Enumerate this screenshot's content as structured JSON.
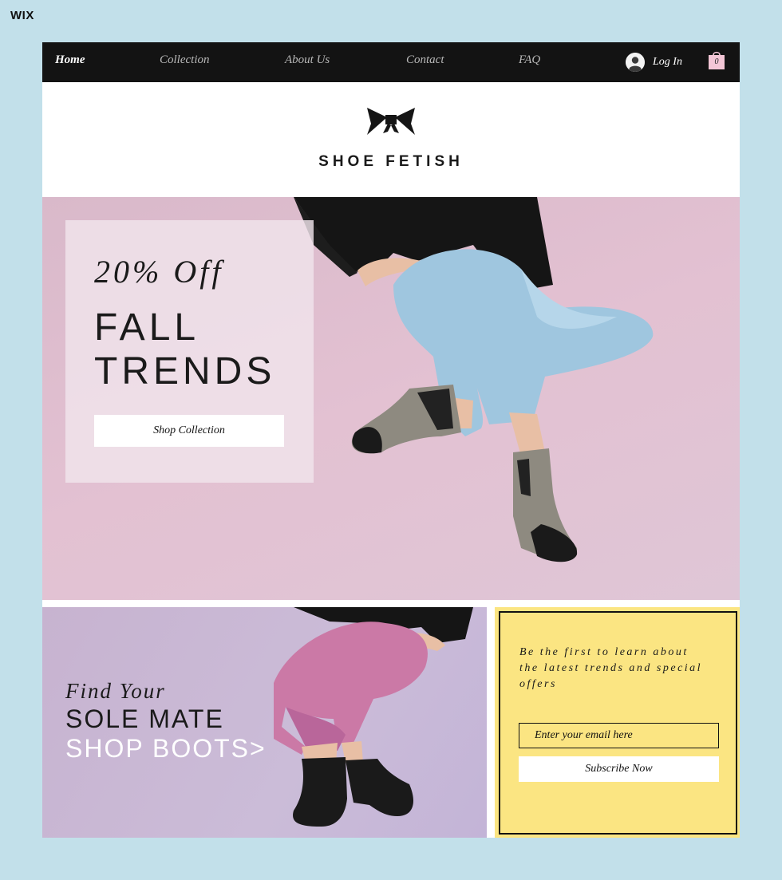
{
  "platform": {
    "logo": "WIX"
  },
  "nav": {
    "items": [
      {
        "label": "Home",
        "active": true
      },
      {
        "label": "Collection",
        "active": false
      },
      {
        "label": "About Us",
        "active": false
      },
      {
        "label": "Contact",
        "active": false
      },
      {
        "label": "FAQ",
        "active": false
      }
    ],
    "login_label": "Log In",
    "cart_count": "0"
  },
  "brand": {
    "name": "SHOE FETISH",
    "icon": "bow-icon"
  },
  "hero": {
    "discount": "20% Off",
    "heading_line1": "FALL",
    "heading_line2": "TRENDS",
    "cta_label": "Shop Collection"
  },
  "boots_banner": {
    "line1": "Find Your",
    "line2": "SOLE MATE",
    "line3": "SHOP BOOTS>"
  },
  "signup": {
    "text": "Be the first to learn about the latest trends and special offers",
    "email_placeholder": "Enter your email here",
    "button_label": "Subscribe Now"
  },
  "colors": {
    "page_bg": "#c2e0ea",
    "nav_bg": "#131313",
    "hero_bg": "#e3c1d2",
    "boots_bg": "#cbbcd8",
    "signup_bg": "#fbe582"
  }
}
